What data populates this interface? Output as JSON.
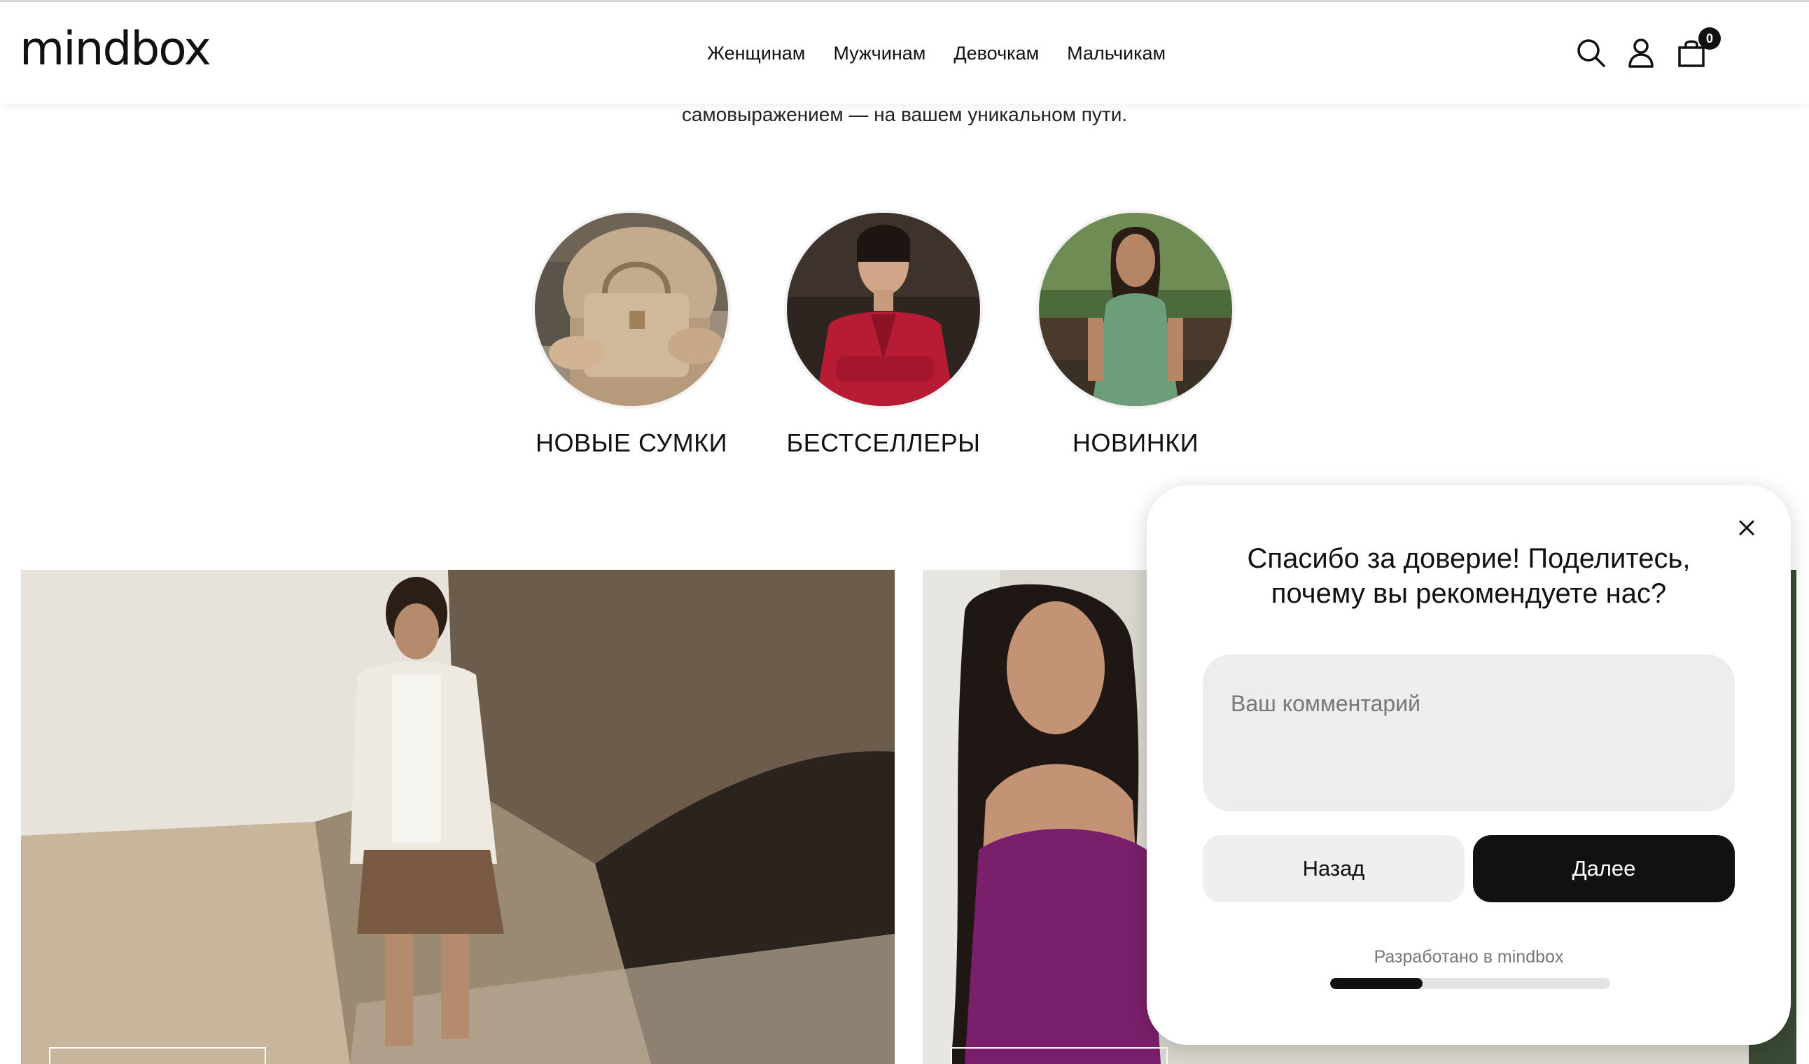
{
  "header": {
    "logo": "mindbox",
    "nav": [
      "Женщинам",
      "Мужчинам",
      "Девочкам",
      "Мальчикам"
    ],
    "icons": [
      "search-icon",
      "user-icon",
      "bag-icon"
    ],
    "cart_count": "0"
  },
  "intro": {
    "text": "самовыражением — на вашем уникальном пути."
  },
  "categories": [
    {
      "label": "НОВЫЕ СУМКИ"
    },
    {
      "label": "БЕСТСЕЛЛЕРЫ"
    },
    {
      "label": "НОВИНКИ"
    }
  ],
  "popup": {
    "title_line1": "Спасибо за доверие! Поделитесь,",
    "title_line2": "почему вы рекомендуете нас?",
    "comment_placeholder": "Ваш комментарий",
    "back_label": "Назад",
    "next_label": "Далее",
    "powered_by": "Разработано в mindbox",
    "progress": 0.33
  }
}
